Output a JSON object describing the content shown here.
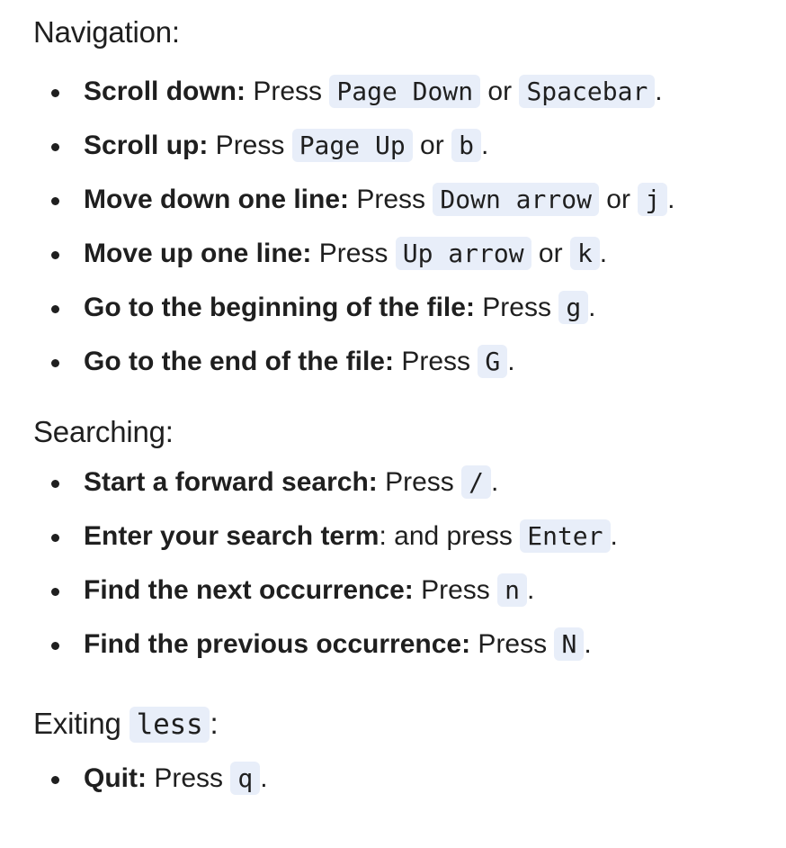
{
  "navigation": {
    "heading": "Navigation:",
    "items": [
      {
        "label": "Scroll down:",
        "pre": " Press ",
        "key1": "Page Down",
        "mid": " or ",
        "key2": "Spacebar",
        "end": "."
      },
      {
        "label": "Scroll up:",
        "pre": " Press ",
        "key1": "Page Up",
        "mid": " or ",
        "key2": "b",
        "end": "."
      },
      {
        "label": "Move down one line:",
        "pre": " Press ",
        "key1": "Down arrow",
        "mid": " or ",
        "key2": "j",
        "end": "."
      },
      {
        "label": "Move up one line:",
        "pre": " Press ",
        "key1": "Up arrow",
        "mid": " or ",
        "key2": "k",
        "end": "."
      },
      {
        "label": "Go to the beginning of the file:",
        "pre": " Press ",
        "key1": "g",
        "end": "."
      },
      {
        "label": "Go to the end of the file:",
        "pre": " Press ",
        "key1": "G",
        "end": "."
      }
    ]
  },
  "searching": {
    "heading": "Searching:",
    "items": [
      {
        "label": "Start a forward search:",
        "pre": " Press ",
        "key1": "/",
        "end": "."
      },
      {
        "label": "Enter your search term",
        "pre": ": and press ",
        "key1": "Enter",
        "end": "."
      },
      {
        "label": "Find the next occurrence:",
        "pre": " Press ",
        "key1": "n",
        "end": "."
      },
      {
        "label": "Find the previous occurrence:",
        "pre": " Press ",
        "key1": "N",
        "end": "."
      }
    ]
  },
  "exiting": {
    "heading_pre": "Exiting ",
    "heading_code": "less",
    "heading_end": ":",
    "items": [
      {
        "label": "Quit:",
        "pre": " Press ",
        "key1": "q",
        "end": "."
      }
    ]
  }
}
